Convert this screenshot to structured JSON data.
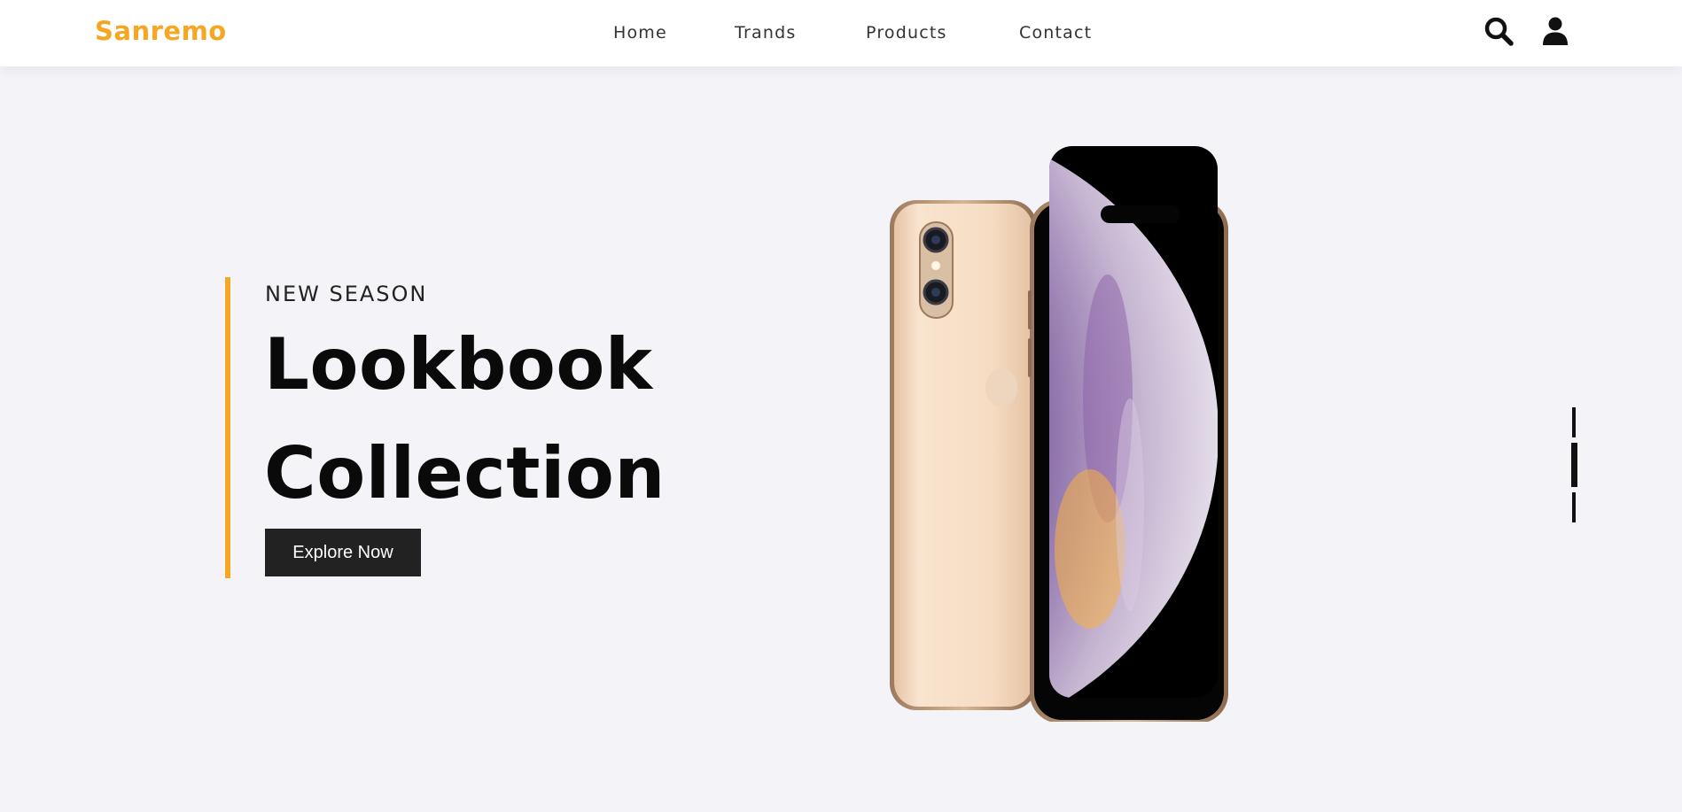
{
  "brand": {
    "name": "Sanremo",
    "accent_color": "#f5a623"
  },
  "nav": {
    "links": [
      {
        "label": "Home"
      },
      {
        "label": "Trands"
      },
      {
        "label": "Products"
      },
      {
        "label": "Contact"
      }
    ],
    "icons": [
      "search-icon",
      "user-icon"
    ]
  },
  "hero": {
    "eyebrow": "NEW SEASON",
    "headline_line1": "Lookbook",
    "headline_line2": "Collection",
    "cta_label": "Explore Now",
    "image": "smartphone-gold-front-back",
    "slider": {
      "slide_count": 3,
      "active_index": 1
    }
  }
}
